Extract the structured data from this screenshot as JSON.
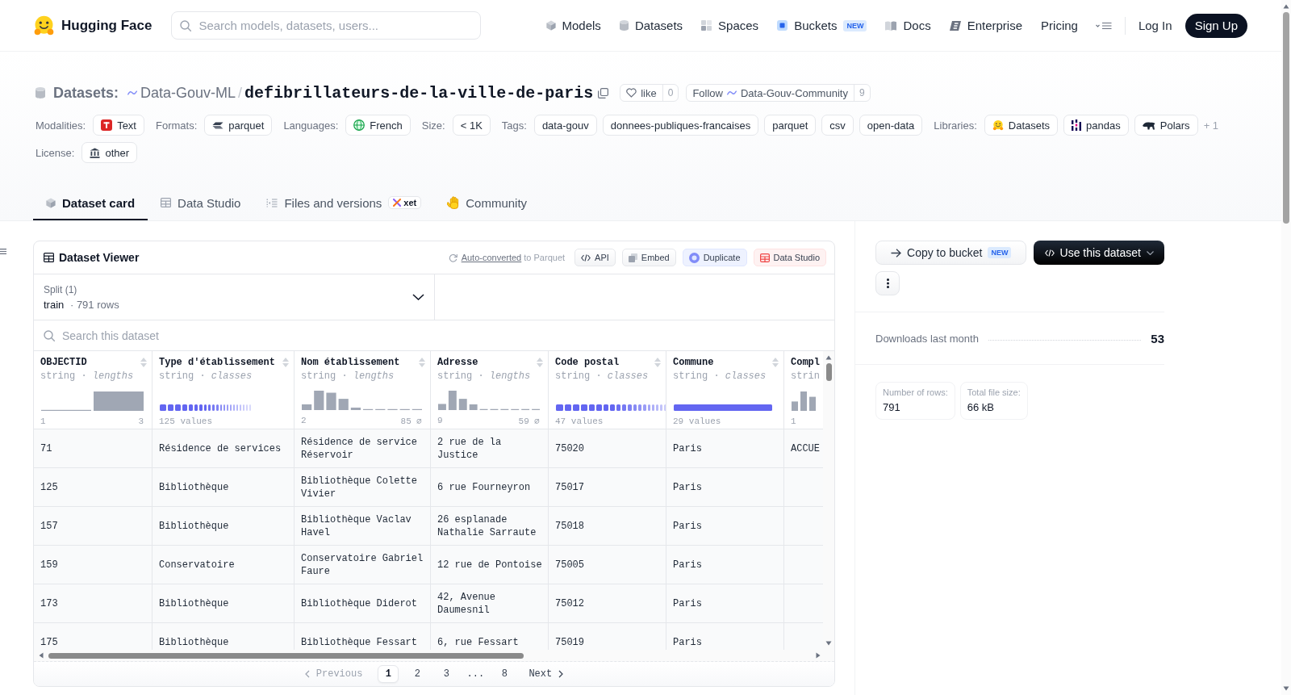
{
  "top_nav": {
    "brand": "Hugging Face",
    "search": {
      "placeholder": "Search models, datasets, users..."
    },
    "links": [
      {
        "label": "Models"
      },
      {
        "label": "Datasets"
      },
      {
        "label": "Spaces"
      },
      {
        "label": "Buckets",
        "badge": "NEW"
      },
      {
        "label": "Docs"
      },
      {
        "label": "Enterprise"
      },
      {
        "label": "Pricing"
      }
    ],
    "login": "Log In",
    "signup": "Sign Up"
  },
  "repo_header": {
    "section": "Datasets:",
    "owner": "Data-Gouv-ML",
    "separator": "/",
    "name": "defibrillateurs-de-la-ville-de-paris",
    "like": {
      "label": "like",
      "count": "0"
    },
    "follow": {
      "label": "Follow",
      "org": "Data-Gouv-Community",
      "count": "9"
    },
    "metadata": [
      {
        "kind": "modality",
        "label": "Modalities:",
        "chips": [
          "Text"
        ]
      },
      {
        "kind": "format",
        "label": "Formats:",
        "chips": [
          "parquet"
        ]
      },
      {
        "kind": "language",
        "label": "Languages:",
        "chips": [
          "French"
        ]
      },
      {
        "kind": "size",
        "label": "Size:",
        "chips": [
          "< 1K"
        ]
      },
      {
        "kind": "tag",
        "label": "Tags:",
        "chips": [
          "data-gouv",
          "donnees-publiques-francaises",
          "parquet",
          "csv",
          "open-data"
        ]
      },
      {
        "kind": "library",
        "label": "Libraries:",
        "chips": [
          "Datasets",
          "pandas",
          "Polars"
        ],
        "more": "+ 1"
      },
      {
        "kind": "license",
        "label": "License:",
        "chips": [
          "other"
        ]
      }
    ]
  },
  "tabs": [
    {
      "label": "Dataset card",
      "selected": true
    },
    {
      "label": "Data Studio",
      "selected": false
    },
    {
      "label": "Files and versions",
      "selected": false,
      "badge": "xet"
    },
    {
      "label": "Community",
      "selected": false
    }
  ],
  "viewer": {
    "title": "Dataset Viewer",
    "conversion": {
      "link": "Auto-converted",
      "text": "to Parquet"
    },
    "actions": [
      {
        "kind": "api",
        "label": "API"
      },
      {
        "kind": "embed",
        "label": "Embed"
      },
      {
        "kind": "duplicate",
        "label": "Duplicate"
      },
      {
        "kind": "studio",
        "label": "Data Studio"
      }
    ],
    "split": {
      "label": "Split (1)",
      "name": "train",
      "separator": "·",
      "rows": "791 rows"
    },
    "search": {
      "placeholder": "Search this dataset"
    },
    "columns": [
      {
        "name": "OBJECTID",
        "type_line": "string · *lengths*",
        "kind": "histogram",
        "min": "1",
        "max": "3"
      },
      {
        "name": "Type d'établissement",
        "type_line": "string · *classes*",
        "kind": "classes",
        "summary": "125 values"
      },
      {
        "name": "Nom établissement",
        "type_line": "string · *lengths*",
        "kind": "histogram",
        "min": "2",
        "max": "85 ⌀"
      },
      {
        "name": "Adresse",
        "type_line": "string · *lengths*",
        "kind": "histogram",
        "min": "9",
        "max": "59 ⌀"
      },
      {
        "name": "Code postal",
        "type_line": "string · *classes*",
        "kind": "classes",
        "summary": "47 values"
      },
      {
        "name": "Commune",
        "type_line": "string · *classes*",
        "kind": "classes",
        "summary": "29 values"
      },
      {
        "name": "Compl",
        "type_line": "strin",
        "kind": "histogram",
        "min": "1"
      }
    ],
    "rows": [
      [
        "71",
        "Résidence de services",
        "Résidence de service Réservoir",
        "2 rue de la Justice",
        "75020",
        "Paris",
        "ACCUE"
      ],
      [
        "125",
        "Bibliothèque",
        "Bibliothèque Colette Vivier",
        "6 rue Fourneyron",
        "75017",
        "Paris"
      ],
      [
        "157",
        "Bibliothèque",
        "Bibliothèque Vaclav Havel",
        "26 esplanade Nathalie Sarraute",
        "75018",
        "Paris"
      ],
      [
        "159",
        "Conservatoire",
        "Conservatoire Gabriel Faure",
        "12 rue de Pontoise",
        "75005",
        "Paris"
      ],
      [
        "173",
        "Bibliothèque",
        "Bibliothèque Diderot",
        "42, Avenue Daumesnil",
        "75012",
        "Paris"
      ],
      [
        "175",
        "Bibliothèque",
        "Bibliothèque Fessart",
        "6, rue Fessart",
        "75019",
        "Paris"
      ]
    ],
    "pagination": {
      "previous": {
        "label": "Previous",
        "disabled": true
      },
      "pages": [
        {
          "label": "1",
          "selected": true
        },
        {
          "label": "2",
          "selected": false
        },
        {
          "label": "3",
          "selected": false
        },
        {
          "label": "...",
          "selected": false
        },
        {
          "label": "8",
          "selected": false
        }
      ],
      "next": {
        "label": "Next",
        "disabled": false
      }
    }
  },
  "sidebar": {
    "actions": [
      {
        "kind": "secondary",
        "label": "Copy to bucket",
        "badge": "NEW"
      },
      {
        "kind": "primary",
        "label": "Use this dataset"
      }
    ],
    "downloads": {
      "label": "Downloads last month",
      "value": "53"
    },
    "stats": [
      {
        "label": "Number of rows:",
        "value": "791"
      },
      {
        "label": "Total file size:",
        "value": "66 kB"
      }
    ]
  }
}
